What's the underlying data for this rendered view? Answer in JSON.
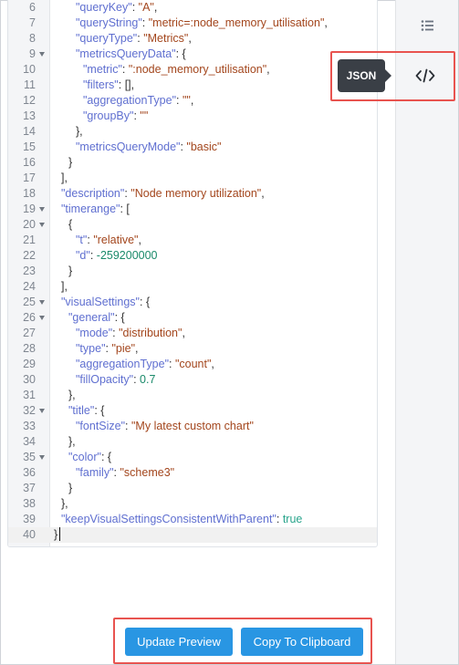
{
  "editor": {
    "lines": [
      {
        "n": "6",
        "fold": false,
        "indent": 3,
        "tokens": [
          [
            "k",
            "\"queryKey\""
          ],
          [
            "p",
            ": "
          ],
          [
            "s",
            "\"A\""
          ],
          [
            "p",
            ","
          ]
        ]
      },
      {
        "n": "7",
        "fold": false,
        "indent": 3,
        "tokens": [
          [
            "k",
            "\"queryString\""
          ],
          [
            "p",
            ": "
          ],
          [
            "s",
            "\"metric=:node_memory_utilisation\""
          ],
          [
            "p",
            ","
          ]
        ]
      },
      {
        "n": "8",
        "fold": false,
        "indent": 3,
        "tokens": [
          [
            "k",
            "\"queryType\""
          ],
          [
            "p",
            ": "
          ],
          [
            "s",
            "\"Metrics\""
          ],
          [
            "p",
            ","
          ]
        ]
      },
      {
        "n": "9",
        "fold": true,
        "indent": 3,
        "tokens": [
          [
            "k",
            "\"metricsQueryData\""
          ],
          [
            "p",
            ": {"
          ]
        ]
      },
      {
        "n": "10",
        "fold": false,
        "indent": 4,
        "tokens": [
          [
            "k",
            "\"metric\""
          ],
          [
            "p",
            ": "
          ],
          [
            "s",
            "\":node_memory_utilisation\""
          ],
          [
            "p",
            ","
          ]
        ]
      },
      {
        "n": "11",
        "fold": false,
        "indent": 4,
        "tokens": [
          [
            "k",
            "\"filters\""
          ],
          [
            "p",
            ": [],"
          ]
        ]
      },
      {
        "n": "12",
        "fold": false,
        "indent": 4,
        "tokens": [
          [
            "k",
            "\"aggregationType\""
          ],
          [
            "p",
            ": "
          ],
          [
            "s",
            "\"\""
          ],
          [
            "p",
            ","
          ]
        ]
      },
      {
        "n": "13",
        "fold": false,
        "indent": 4,
        "tokens": [
          [
            "k",
            "\"groupBy\""
          ],
          [
            "p",
            ": "
          ],
          [
            "s",
            "\"\""
          ]
        ]
      },
      {
        "n": "14",
        "fold": false,
        "indent": 3,
        "tokens": [
          [
            "p",
            "},"
          ]
        ]
      },
      {
        "n": "15",
        "fold": false,
        "indent": 3,
        "tokens": [
          [
            "k",
            "\"metricsQueryMode\""
          ],
          [
            "p",
            ": "
          ],
          [
            "s",
            "\"basic\""
          ]
        ]
      },
      {
        "n": "16",
        "fold": false,
        "indent": 2,
        "tokens": [
          [
            "p",
            "}"
          ]
        ]
      },
      {
        "n": "17",
        "fold": false,
        "indent": 1,
        "tokens": [
          [
            "p",
            "],"
          ]
        ]
      },
      {
        "n": "18",
        "fold": false,
        "indent": 1,
        "tokens": [
          [
            "k",
            "\"description\""
          ],
          [
            "p",
            ": "
          ],
          [
            "s",
            "\"Node memory utilization\""
          ],
          [
            "p",
            ","
          ]
        ]
      },
      {
        "n": "19",
        "fold": true,
        "indent": 1,
        "tokens": [
          [
            "k",
            "\"timerange\""
          ],
          [
            "p",
            ": ["
          ]
        ]
      },
      {
        "n": "20",
        "fold": true,
        "indent": 2,
        "tokens": [
          [
            "p",
            "{"
          ]
        ]
      },
      {
        "n": "21",
        "fold": false,
        "indent": 3,
        "tokens": [
          [
            "k",
            "\"t\""
          ],
          [
            "p",
            ": "
          ],
          [
            "s",
            "\"relative\""
          ],
          [
            "p",
            ","
          ]
        ]
      },
      {
        "n": "22",
        "fold": false,
        "indent": 3,
        "tokens": [
          [
            "k",
            "\"d\""
          ],
          [
            "p",
            ": "
          ],
          [
            "n",
            "-259200000"
          ]
        ]
      },
      {
        "n": "23",
        "fold": false,
        "indent": 2,
        "tokens": [
          [
            "p",
            "}"
          ]
        ]
      },
      {
        "n": "24",
        "fold": false,
        "indent": 1,
        "tokens": [
          [
            "p",
            "],"
          ]
        ]
      },
      {
        "n": "25",
        "fold": true,
        "indent": 1,
        "tokens": [
          [
            "k",
            "\"visualSettings\""
          ],
          [
            "p",
            ": {"
          ]
        ]
      },
      {
        "n": "26",
        "fold": true,
        "indent": 2,
        "tokens": [
          [
            "k",
            "\"general\""
          ],
          [
            "p",
            ": {"
          ]
        ]
      },
      {
        "n": "27",
        "fold": false,
        "indent": 3,
        "tokens": [
          [
            "k",
            "\"mode\""
          ],
          [
            "p",
            ": "
          ],
          [
            "s",
            "\"distribution\""
          ],
          [
            "p",
            ","
          ]
        ]
      },
      {
        "n": "28",
        "fold": false,
        "indent": 3,
        "tokens": [
          [
            "k",
            "\"type\""
          ],
          [
            "p",
            ": "
          ],
          [
            "s",
            "\"pie\""
          ],
          [
            "p",
            ","
          ]
        ]
      },
      {
        "n": "29",
        "fold": false,
        "indent": 3,
        "tokens": [
          [
            "k",
            "\"aggregationType\""
          ],
          [
            "p",
            ": "
          ],
          [
            "s",
            "\"count\""
          ],
          [
            "p",
            ","
          ]
        ]
      },
      {
        "n": "30",
        "fold": false,
        "indent": 3,
        "tokens": [
          [
            "k",
            "\"fillOpacity\""
          ],
          [
            "p",
            ": "
          ],
          [
            "n",
            "0.7"
          ]
        ]
      },
      {
        "n": "31",
        "fold": false,
        "indent": 2,
        "tokens": [
          [
            "p",
            "},"
          ]
        ]
      },
      {
        "n": "32",
        "fold": true,
        "indent": 2,
        "tokens": [
          [
            "k",
            "\"title\""
          ],
          [
            "p",
            ": {"
          ]
        ]
      },
      {
        "n": "33",
        "fold": false,
        "indent": 3,
        "tokens": [
          [
            "k",
            "\"fontSize\""
          ],
          [
            "p",
            ": "
          ],
          [
            "s",
            "\"My latest custom chart\""
          ]
        ]
      },
      {
        "n": "34",
        "fold": false,
        "indent": 2,
        "tokens": [
          [
            "p",
            "},"
          ]
        ]
      },
      {
        "n": "35",
        "fold": true,
        "indent": 2,
        "tokens": [
          [
            "k",
            "\"color\""
          ],
          [
            "p",
            ": {"
          ]
        ]
      },
      {
        "n": "36",
        "fold": false,
        "indent": 3,
        "tokens": [
          [
            "k",
            "\"family\""
          ],
          [
            "p",
            ": "
          ],
          [
            "s",
            "\"scheme3\""
          ]
        ]
      },
      {
        "n": "37",
        "fold": false,
        "indent": 2,
        "tokens": [
          [
            "p",
            "}"
          ]
        ]
      },
      {
        "n": "38",
        "fold": false,
        "indent": 1,
        "tokens": [
          [
            "p",
            "},"
          ]
        ]
      },
      {
        "n": "39",
        "fold": false,
        "indent": 1,
        "tokens": [
          [
            "k",
            "\"keepVisualSettingsConsistentWithParent\""
          ],
          [
            "p",
            ": "
          ],
          [
            "b",
            "true"
          ]
        ]
      },
      {
        "n": "40",
        "fold": false,
        "indent": 0,
        "active": true,
        "tokens": [
          [
            "p",
            "}"
          ]
        ]
      }
    ]
  },
  "sidebar": {
    "tooltip": "JSON",
    "list_icon": "list-view-icon",
    "code_icon": "code-view-icon"
  },
  "actions": {
    "update_preview": "Update Preview",
    "copy_to_clipboard": "Copy To Clipboard"
  },
  "colors": {
    "button": "#2996e3",
    "highlight": "#e8534f",
    "key": "#5f6fd0",
    "string": "#a3461d",
    "number": "#1a8a6a"
  }
}
